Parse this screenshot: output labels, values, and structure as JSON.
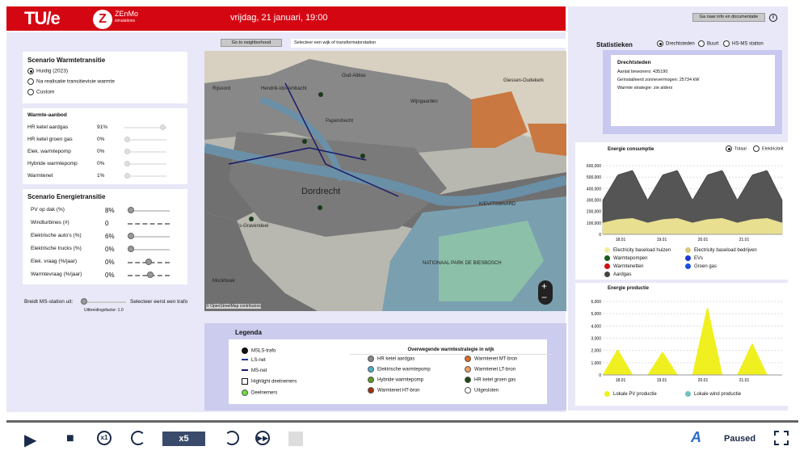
{
  "header": {
    "logo": "TU/e",
    "zenmo_letter": "Z",
    "zenmo_name": "ZEnMo",
    "zenmo_sub": "simulations",
    "datetime": "vrijdag, 21 januari, 19:00",
    "info_button": "Ga naar info en documentatie",
    "info_icon": "i"
  },
  "map_controls": {
    "neighborhood_button": "Go to neighborhood",
    "select_label": "Selecteer een wijk of transformatorstation",
    "zoom_in": "+",
    "zoom_out": "−",
    "attribution": "© OpenStreetMap contributors"
  },
  "map_labels": [
    {
      "text": "Oud-Alblas"
    },
    {
      "text": "Hendrik-Ido-Ambacht"
    },
    {
      "text": "Papendrecht"
    },
    {
      "text": "Wijngaarden"
    },
    {
      "text": "Giessen-Oudekerk"
    },
    {
      "text": "Dordrecht"
    },
    {
      "text": "Rijsoord"
    },
    {
      "text": "'s-Gravendeel"
    },
    {
      "text": "Mookhoek"
    },
    {
      "text": "KIEVITSWAARD"
    },
    {
      "text": "NATIONAAL PARK DE BIESBOSCH"
    }
  ],
  "scenario_warmte": {
    "title": "Scenario Warmtetransitie",
    "options": [
      "Huidig (2023)",
      "Na realisatie transitievisie warmte",
      "Custom"
    ],
    "selected": 0
  },
  "warmte_aanbod": {
    "title": "Warmte-aanbod",
    "rows": [
      {
        "label": "HR ketel aardgas",
        "value": "91%",
        "level": 0.91
      },
      {
        "label": "HR ketel groen gas",
        "value": "0%",
        "level": 0
      },
      {
        "label": "Elek. warmtepomp",
        "value": "0%",
        "level": 0
      },
      {
        "label": "Hybride warmtepomp",
        "value": "0%",
        "level": 0
      },
      {
        "label": "Warmtenet",
        "value": "1%",
        "level": 0.01
      }
    ]
  },
  "scenario_energie": {
    "title": "Scenario Energietransitie",
    "rows": [
      {
        "label": "PV op dak (%)",
        "value": "8%"
      },
      {
        "label": "Windturbines (#)",
        "value": "0"
      },
      {
        "label": "Elektrische auto's (%)",
        "value": "6%"
      },
      {
        "label": "Elektrische trucks (%)",
        "value": "0%"
      },
      {
        "label": "Elek. vraag (%/jaar)",
        "value": "0%"
      },
      {
        "label": "Warmtevraag (%/jaar)",
        "value": "0%"
      }
    ]
  },
  "ms_station": {
    "label": "Breidt MS-station uit:",
    "hint": "Selecteer eerst een trafo",
    "factor": "Uitbreidingsfactor: 1.0"
  },
  "legend": {
    "title": "Legenda",
    "left": [
      "MSLS-trafo",
      "LS-net",
      "MS-net",
      "Highlight deelnemers",
      "Deelnemers"
    ],
    "strategy_title": "Overwegende warmtestrategie in wijk",
    "strategies": [
      {
        "label": "HR ketel aardgas",
        "color": "#888888"
      },
      {
        "label": "Warmtenet MT-bron",
        "color": "#e06a20"
      },
      {
        "label": "Elektrische warmtepomp",
        "color": "#4ab0c8"
      },
      {
        "label": "Warmtenet LT-bron",
        "color": "#f0a060"
      },
      {
        "label": "Hybride warmtepomp",
        "color": "#5a9a20"
      },
      {
        "label": "HR ketel groen gas",
        "color": "#1a4a10"
      },
      {
        "label": "Warmtenet HT-bron",
        "color": "#a03010"
      },
      {
        "label": "Uitgesloten",
        "color": "#ffffff"
      }
    ]
  },
  "statistieken": {
    "title": "Statistieken",
    "options": [
      "Drechtsteden",
      "Buurt",
      "HS-MS station"
    ],
    "selected": 0,
    "box_title": "Drechtsteden",
    "lines": [
      "Aantal bewoners: 435190",
      "Geïnstalleerd zonnevermogen: 25734 kW",
      "Warmte strategie: zie alders"
    ]
  },
  "consumptie": {
    "title": "Energie consumptie",
    "options": [
      "Totaal",
      "Elektriciteit"
    ],
    "selected": 0,
    "legend": [
      {
        "label": "Electricity baseload huizen",
        "color": "#f0f0a0"
      },
      {
        "label": "Electricity baseload bedrijven",
        "color": "#d8c880"
      },
      {
        "label": "Warmtepompen",
        "color": "#1a5a1a"
      },
      {
        "label": "EVs",
        "color": "#1a3ad0"
      },
      {
        "label": "Warmtenetten",
        "color": "#d01010"
      },
      {
        "label": "Groen gas",
        "color": "#1a50e0"
      },
      {
        "label": "Aardgas",
        "color": "#444444"
      }
    ]
  },
  "productie": {
    "title": "Energie productie",
    "legend": [
      {
        "label": "Lokale PV productie",
        "color": "#f0f020"
      },
      {
        "label": "Lokale wind productie",
        "color": "#70c0c0"
      }
    ]
  },
  "chart_data": [
    {
      "type": "area",
      "title": "Energie consumptie",
      "x_ticks": [
        "18.01",
        "19.01",
        "20.01",
        "21.01"
      ],
      "y_ticks": [
        "0",
        "100,000",
        "200,000",
        "300,000",
        "400,000",
        "500,000",
        "600,000"
      ],
      "ylim": [
        0,
        650000
      ],
      "series": [
        {
          "name": "Aardgas",
          "values": [
            300000,
            520000,
            560000,
            300000,
            520000,
            560000,
            300000,
            520000,
            560000,
            300000,
            520000,
            560000
          ]
        },
        {
          "name": "Electricity baseload huizen",
          "values": [
            100000,
            130000,
            140000,
            100000,
            130000,
            140000,
            100000,
            130000,
            140000,
            100000,
            130000,
            140000
          ]
        }
      ]
    },
    {
      "type": "area",
      "title": "Energie productie",
      "x_ticks": [
        "18.01",
        "19.01",
        "20.01",
        "21.01"
      ],
      "y_ticks": [
        "0",
        "1,000",
        "2,000",
        "3,000",
        "4,000",
        "5,000",
        "6,000"
      ],
      "ylim": [
        0,
        6200
      ],
      "series": [
        {
          "name": "Lokale PV productie",
          "values": [
            0,
            2100,
            0,
            0,
            1900,
            0,
            0,
            5600,
            0,
            0,
            2600,
            0
          ]
        }
      ]
    }
  ],
  "playback": {
    "speed": "x5",
    "status": "Paused",
    "speed_x1": "x1"
  }
}
